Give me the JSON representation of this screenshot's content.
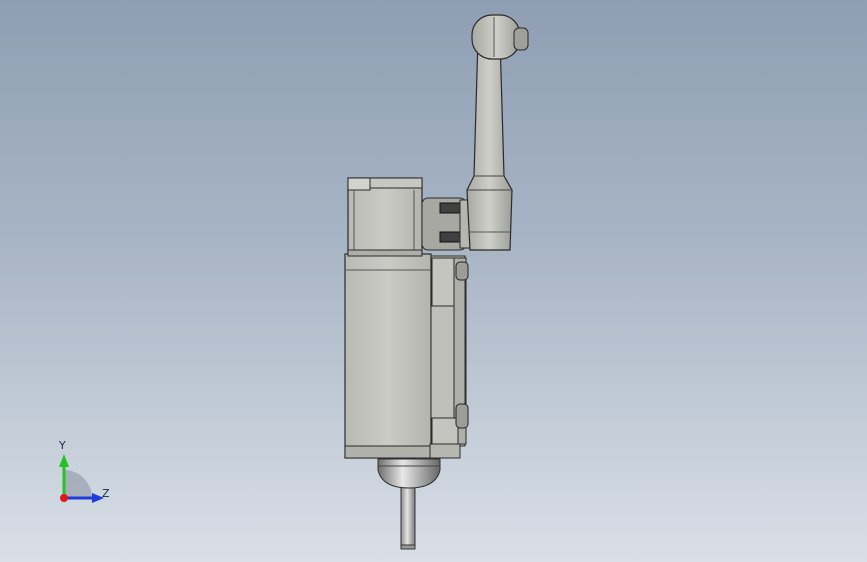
{
  "viewport": {
    "background_top": "#8f9eb3",
    "background_bottom": "#d9dfe6"
  },
  "model": {
    "body_color": "#c6c7c0",
    "edge_color": "#2a2a2a",
    "plunger_color": "#b8b8b8"
  },
  "triad": {
    "y_label": "Y",
    "z_label": "Z",
    "y_color": "#22c322",
    "z_color": "#1e3cd8",
    "x_color": "#e01818"
  }
}
